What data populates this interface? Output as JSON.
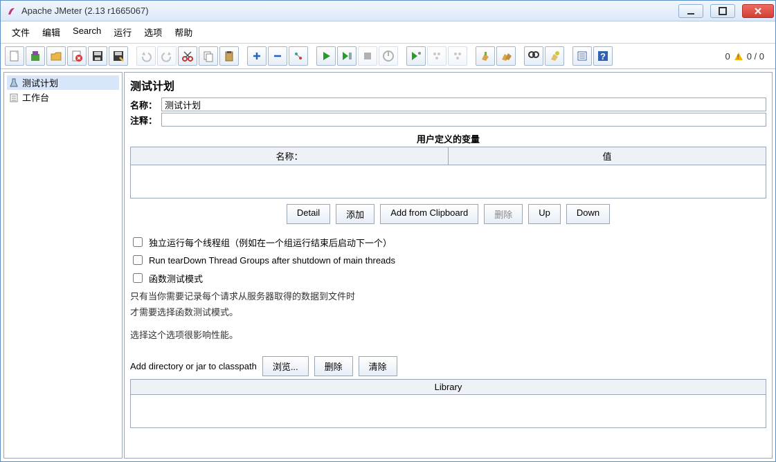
{
  "window": {
    "title": "Apache JMeter (2.13 r1665067)"
  },
  "menu": {
    "file": "文件",
    "edit": "编辑",
    "search": "Search",
    "run": "运行",
    "options": "选项",
    "help": "帮助"
  },
  "toolbar_right": {
    "left_count": "0",
    "left_warn": "!",
    "right_count": "0 / 0"
  },
  "tree": {
    "plan": "测试计划",
    "workbench": "工作台"
  },
  "panel": {
    "title": "测试计划",
    "name_label": "名称：",
    "name_value": "测试计划",
    "comment_label": "注释：",
    "comment_value": "",
    "vars_title": "用户定义的变量",
    "vars_col_name": "名称：",
    "vars_col_value": "值",
    "btn_detail": "Detail",
    "btn_add": "添加",
    "btn_clip": "Add from Clipboard",
    "btn_delete": "删除",
    "btn_up": "Up",
    "btn_down": "Down",
    "chk1": "独立运行每个线程组（例如在一个组运行结束后启动下一个）",
    "chk2": "Run tearDown Thread Groups after shutdown of main threads",
    "chk3": "函数测试模式",
    "hint1": "只有当你需要记录每个请求从服务器取得的数据到文件时",
    "hint2": "才需要选择函数测试模式。",
    "hint3": "选择这个选项很影响性能。",
    "cp_label": "Add directory or jar to classpath",
    "cp_browse": "浏览...",
    "cp_delete": "删除",
    "cp_clear": "清除",
    "cp_col": "Library"
  }
}
